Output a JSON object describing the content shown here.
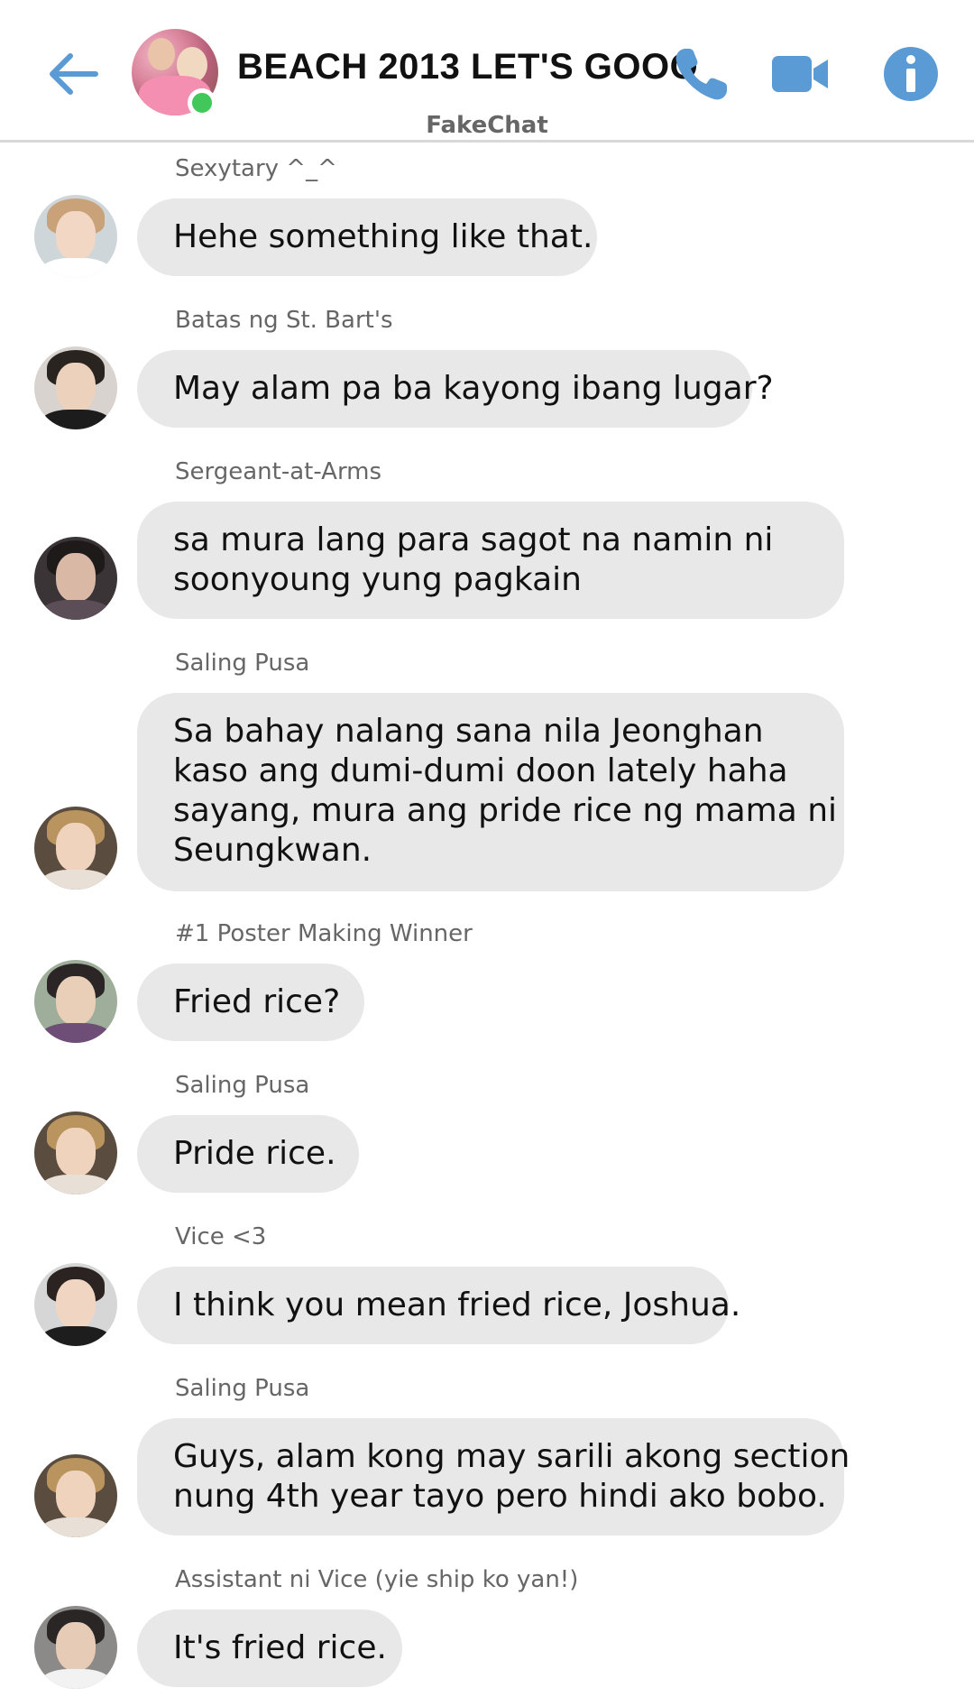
{
  "header": {
    "title": "BEACH 2013 LET'S GOOO",
    "subtitle": "FakeChat",
    "accent_color": "#5b9bd5",
    "online_color": "#42c75a",
    "icons": [
      "arrow-left-icon",
      "phone-icon",
      "video-camera-icon",
      "info-icon"
    ]
  },
  "messages": [
    {
      "sender": "Sexytary ^_^",
      "lines": [
        "Hehe something like that."
      ]
    },
    {
      "sender": "Batas ng St. Bart's",
      "lines": [
        "May alam pa ba kayong ibang lugar?"
      ]
    },
    {
      "sender": "Sergeant-at-Arms",
      "lines": [
        "sa mura lang para sagot na namin ni",
        "soonyoung yung pagkain"
      ]
    },
    {
      "sender": "Saling Pusa",
      "lines": [
        "Sa bahay nalang sana nila Jeonghan",
        "kaso ang dumi-dumi doon lately haha",
        "sayang, mura ang pride rice ng mama ni",
        "Seungkwan."
      ]
    },
    {
      "sender": "#1 Poster Making Winner",
      "lines": [
        "Fried rice?"
      ]
    },
    {
      "sender": "Saling Pusa",
      "lines": [
        "Pride rice."
      ]
    },
    {
      "sender": "Vice <3",
      "lines": [
        "I think you mean fried rice, Joshua."
      ]
    },
    {
      "sender": "Saling Pusa",
      "lines": [
        "Guys, alam kong may sarili akong section",
        "nung 4th year tayo pero hindi ako bobo."
      ]
    },
    {
      "sender": "Assistant ni Vice (yie ship ko yan!)",
      "lines": [
        "It's fried rice."
      ]
    }
  ]
}
